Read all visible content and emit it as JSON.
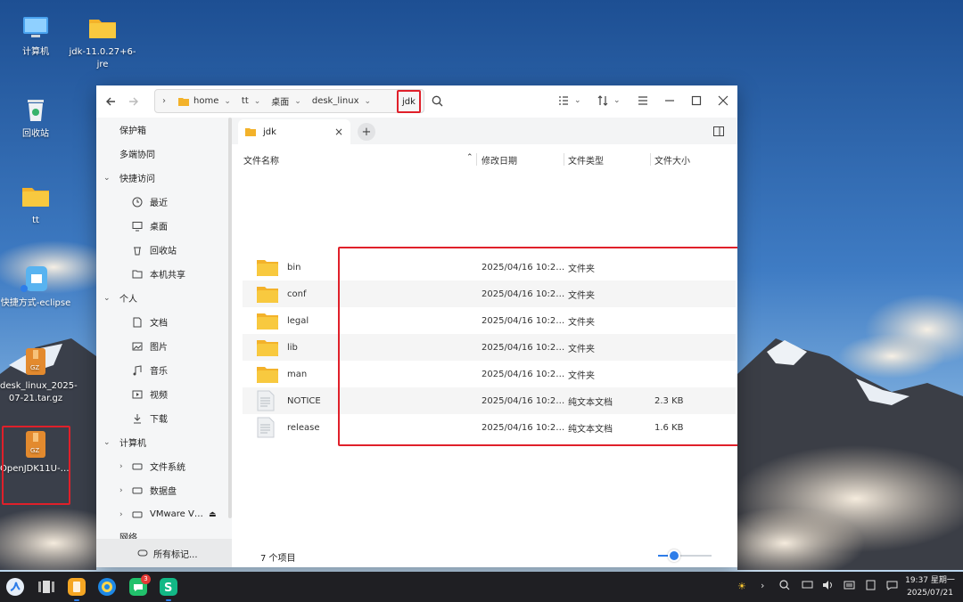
{
  "desktop": {
    "icons": [
      {
        "label": "计算机"
      },
      {
        "label": "jdk-11.0.27+6-jre"
      },
      {
        "label": "回收站"
      },
      {
        "label": "tt"
      },
      {
        "label": "快捷方式-eclipse"
      },
      {
        "label": "desk_linux_2025-07-21.tar.gz"
      },
      {
        "label": "OpenJDK11U-jre_x64_linu…"
      }
    ]
  },
  "window": {
    "breadcrumb": [
      "home",
      "tt",
      "桌面",
      "desk_linux",
      "jdk"
    ],
    "tab_label": "jdk",
    "columns": {
      "name": "文件名称",
      "modified": "修改日期",
      "type": "文件类型",
      "size": "文件大小"
    },
    "files": [
      {
        "name": "bin",
        "modified": "2025/04/16 10:2…",
        "type": "文件夹",
        "size": "",
        "icon": "folder"
      },
      {
        "name": "conf",
        "modified": "2025/04/16 10:2…",
        "type": "文件夹",
        "size": "",
        "icon": "folder"
      },
      {
        "name": "legal",
        "modified": "2025/04/16 10:2…",
        "type": "文件夹",
        "size": "",
        "icon": "folder"
      },
      {
        "name": "lib",
        "modified": "2025/04/16 10:2…",
        "type": "文件夹",
        "size": "",
        "icon": "folder"
      },
      {
        "name": "man",
        "modified": "2025/04/16 10:2…",
        "type": "文件夹",
        "size": "",
        "icon": "folder"
      },
      {
        "name": "NOTICE",
        "modified": "2025/04/16 10:2…",
        "type": "纯文本文档",
        "size": "2.3 KB",
        "icon": "text-file"
      },
      {
        "name": "release",
        "modified": "2025/04/16 10:2…",
        "type": "纯文本文档",
        "size": "1.6 KB",
        "icon": "text-file"
      }
    ],
    "status_text": "7 个项目"
  },
  "sidebar": {
    "vault": "保护箱",
    "multi": "多端协同",
    "quick_access": "快捷访问",
    "recent": "最近",
    "desktop": "桌面",
    "trash": "回收站",
    "share": "本机共享",
    "personal": "个人",
    "documents": "文档",
    "pictures": "图片",
    "music": "音乐",
    "videos": "视频",
    "downloads": "下载",
    "computer": "计算机",
    "filesystem": "文件系统",
    "datadisk": "数据盘",
    "vmware": "VMware V…",
    "network": "网络",
    "all_tags": "所有标记..."
  },
  "taskbar": {
    "badge": "3",
    "time": "19:37 星期一",
    "date": "2025/07/21"
  },
  "colors": {
    "folder": "#f8c23a",
    "accent": "#2e7de9",
    "highlight": "#e0202a"
  }
}
